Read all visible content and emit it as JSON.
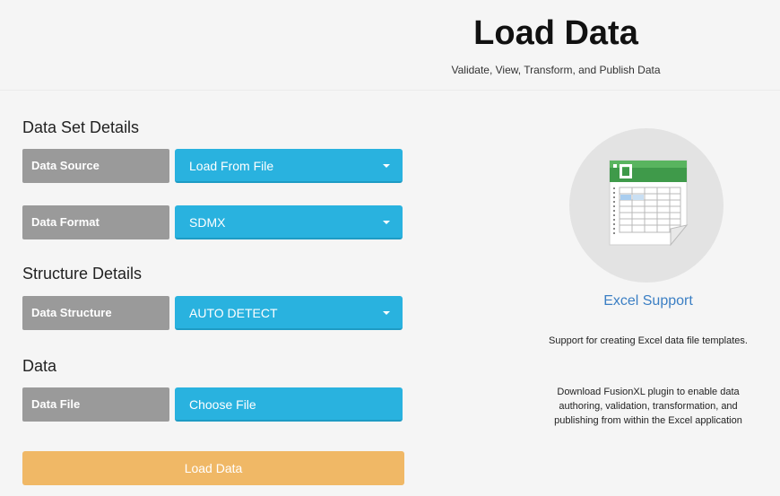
{
  "header": {
    "title": "Load Data",
    "subtitle": "Validate, View, Transform, and Publish Data"
  },
  "form": {
    "sections": {
      "dataset_details": "Data Set Details",
      "structure_details": "Structure Details",
      "data": "Data"
    },
    "data_source": {
      "label": "Data Source",
      "value": "Load From File"
    },
    "data_format": {
      "label": "Data Format",
      "value": "SDMX"
    },
    "data_structure": {
      "label": "Data Structure",
      "value": "AUTO DETECT"
    },
    "data_file": {
      "label": "Data File",
      "button": "Choose File"
    },
    "submit_label": "Load Data"
  },
  "excel_panel": {
    "icon": "excel-spreadsheet-icon",
    "heading": "Excel Support",
    "text1": "Support for creating Excel data file templates.",
    "text2": "Download FusionXL plugin to enable data authoring, validation, transformation, and publishing from within the Excel application"
  },
  "colors": {
    "accent": "#29b2df",
    "label_bg": "#9a9a9a",
    "button": "#f0b866",
    "link": "#3b7fc4"
  }
}
